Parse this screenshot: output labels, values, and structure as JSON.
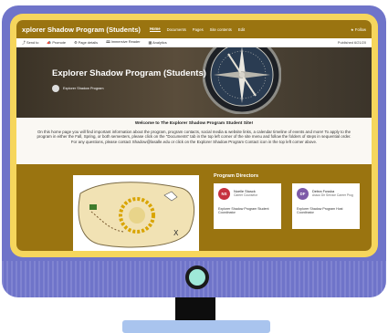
{
  "site": {
    "name": "xplorer Shadow Program (Students)",
    "nav": [
      "Home",
      "Documents",
      "Pages",
      "Site contents",
      "Edit"
    ],
    "follow": "★ Follow"
  },
  "commands": {
    "send_to": "Send to",
    "promote": "Promote",
    "page_details": "Page details",
    "immersive_reader": "Immersive Reader",
    "analytics": "Analytics",
    "published": "Published 6/21/20"
  },
  "hero": {
    "title": "Explorer Shadow Program (Students)",
    "author": "Explorer Shadow Program"
  },
  "welcome": {
    "heading": "Welcome to The Explorer Shadow Program Student Site!",
    "body": "On this home page you will find important information about the program, program contacts, social media & website links, a calendar timeline of events and more! To apply to the program in either the Fall, Spring, or both semesters, please click on the \"Documents\" tab in the top left corner of the site menu and follow the folders of steps in sequential order. For any questions, please contact Shadow@lasalle.edu or click on the Explorer Shadow Program Contact icon in the top left corner above."
  },
  "directors": {
    "title": "Program Directors",
    "people": [
      {
        "initials": "NS",
        "name": "Noelle Stusck",
        "role": "Career Counselor",
        "desc": "Explorer Shadow Program Student Coordinator",
        "color": "#c6323f"
      },
      {
        "initials": "DF",
        "name": "Debra Fusska",
        "role": "Assoc Dir Service Career Prog",
        "desc": "Explorer Shadow Program Host Coordinator",
        "color": "#7d5aa8"
      }
    ]
  }
}
